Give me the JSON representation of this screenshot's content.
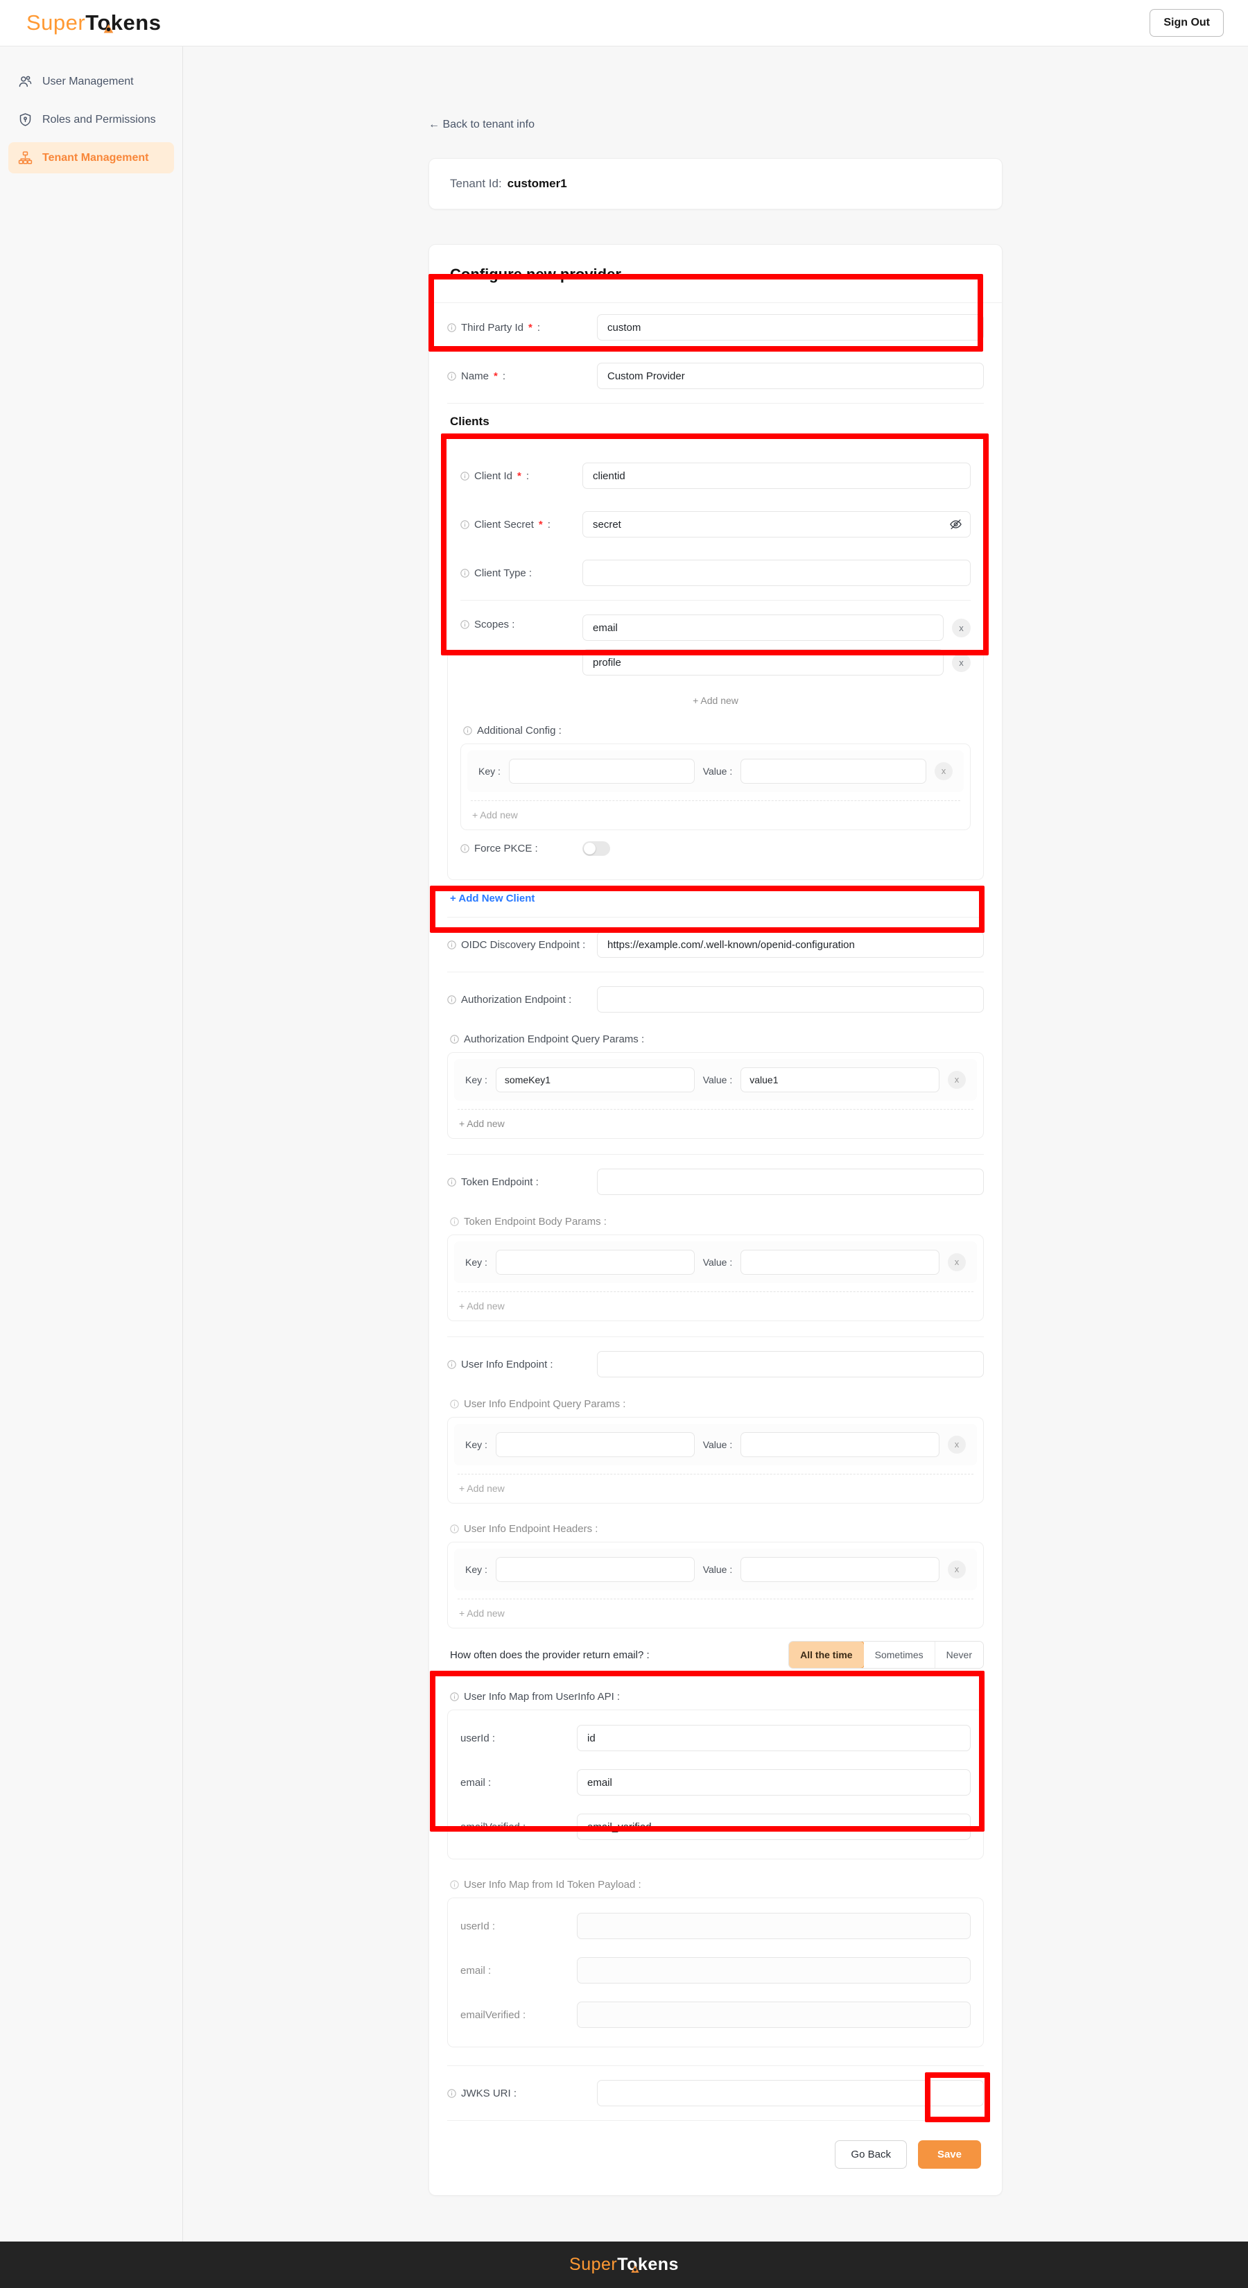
{
  "brand": {
    "name_part1": "Super",
    "name_part2": "Tokens"
  },
  "topbar": {
    "sign_out_label": "Sign Out"
  },
  "sidebar": {
    "items": [
      {
        "label": "User Management",
        "icon": "users-icon",
        "active": false
      },
      {
        "label": "Roles and Permissions",
        "icon": "shield-key-icon",
        "active": false
      },
      {
        "label": "Tenant Management",
        "icon": "org-chart-icon",
        "active": true
      }
    ]
  },
  "page": {
    "back_link": "← Back to tenant info",
    "tenant": {
      "label": "Tenant Id:",
      "value": "customer1"
    },
    "form_title": "Configure new provider"
  },
  "provider": {
    "third_party_id": {
      "label": "Third Party Id",
      "required": "*",
      "suffix": ":",
      "value": "custom"
    },
    "name": {
      "label": "Name",
      "required": "*",
      "suffix": ":",
      "value": "Custom Provider"
    }
  },
  "clients": {
    "section_title": "Clients",
    "client_id": {
      "label": "Client Id",
      "required": "*",
      "suffix": ":",
      "value": "clientid"
    },
    "client_secret": {
      "label": "Client Secret",
      "required": "*",
      "suffix": ":",
      "value": "secret",
      "icon": "eye-off-icon"
    },
    "client_type": {
      "label": "Client Type :",
      "value": ""
    },
    "scopes": {
      "label": "Scopes :",
      "values": [
        "email",
        "profile"
      ],
      "remove_label": "x",
      "add_new_label": "+ Add new"
    },
    "additional_config": {
      "label": "Additional Config :",
      "key_label": "Key :",
      "value_label": "Value :",
      "rows": [
        {
          "key": "",
          "value": ""
        }
      ],
      "remove_label": "x",
      "add_new_label": "+ Add new"
    },
    "force_pkce": {
      "label": "Force PKCE :",
      "enabled": false
    },
    "add_new_client_label": "+ Add New Client"
  },
  "endpoints": {
    "oidc_discovery": {
      "label": "OIDC Discovery Endpoint :",
      "value": "https://example.com/.well-known/openid-configuration"
    },
    "authorization": {
      "label": "Authorization Endpoint :",
      "value": ""
    },
    "authorization_query_params": {
      "label": "Authorization Endpoint Query Params :",
      "key_label": "Key :",
      "value_label": "Value :",
      "rows": [
        {
          "key": "someKey1",
          "value": "value1"
        }
      ],
      "remove_label": "x",
      "add_new_label": "+ Add new"
    },
    "token": {
      "label": "Token Endpoint :",
      "value": ""
    },
    "token_body_params": {
      "label": "Token Endpoint Body Params :",
      "key_label": "Key :",
      "value_label": "Value :",
      "rows": [
        {
          "key": "",
          "value": ""
        }
      ],
      "remove_label": "x",
      "add_new_label": "+ Add new"
    },
    "user_info": {
      "label": "User Info Endpoint :",
      "value": ""
    },
    "user_info_query_params": {
      "label": "User Info Endpoint Query Params :",
      "key_label": "Key :",
      "value_label": "Value :",
      "rows": [
        {
          "key": "",
          "value": ""
        }
      ],
      "remove_label": "x",
      "add_new_label": "+ Add new"
    },
    "user_info_headers": {
      "label": "User Info Endpoint Headers :",
      "key_label": "Key :",
      "value_label": "Value :",
      "rows": [
        {
          "key": "",
          "value": ""
        }
      ],
      "remove_label": "x",
      "add_new_label": "+ Add new"
    },
    "jwks_uri": {
      "label": "JWKS URI :",
      "value": ""
    }
  },
  "email_frequency": {
    "question": "How often does the provider return email? :",
    "options": [
      "All the time",
      "Sometimes",
      "Never"
    ],
    "selected": "All the time"
  },
  "user_info_map_userinfo_api": {
    "label": "User Info Map from UserInfo API :",
    "fields": [
      {
        "label": "userId :",
        "value": "id"
      },
      {
        "label": "email :",
        "value": "email"
      },
      {
        "label": "emailVerified :",
        "value": "email_verified"
      }
    ]
  },
  "user_info_map_id_token": {
    "label": "User Info Map from Id Token Payload :",
    "fields": [
      {
        "label": "userId :",
        "value": ""
      },
      {
        "label": "email :",
        "value": ""
      },
      {
        "label": "emailVerified :",
        "value": ""
      }
    ]
  },
  "actions": {
    "go_back_label": "Go Back",
    "save_label": "Save"
  },
  "colors": {
    "accent_orange": "#f8873a",
    "save_orange": "#f59440",
    "link_blue": "#2979ff",
    "annotation_red": "#ff0000",
    "required_red": "#ff2d2d",
    "footer_dark": "#242424"
  }
}
